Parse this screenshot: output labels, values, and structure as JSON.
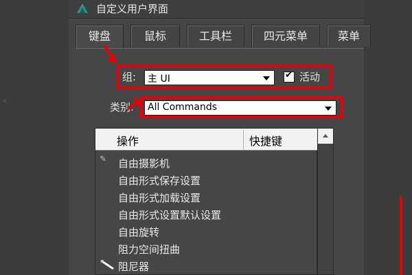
{
  "window": {
    "title": "自定义用户界面",
    "icon": "3dsmax-app-icon"
  },
  "tabs": [
    "键盘",
    "鼠标",
    "工具栏",
    "四元菜单",
    "菜单"
  ],
  "active_tab": "键盘",
  "group": {
    "label": "组:",
    "value": "主 UI",
    "active_label": "活动",
    "active_checked": true
  },
  "category": {
    "label": "类别:",
    "value": "All Commands"
  },
  "list": {
    "col_action": "操作",
    "col_shortcut": "快捷键",
    "items": [
      {
        "label": "自由摄影机",
        "icon": "camera-icon"
      },
      {
        "label": "自由形式保存设置",
        "icon": ""
      },
      {
        "label": "自由形式加载设置",
        "icon": ""
      },
      {
        "label": "自由形式设置默认设置",
        "icon": ""
      },
      {
        "label": "自由旋转",
        "icon": ""
      },
      {
        "label": "阻力空间扭曲",
        "icon": ""
      },
      {
        "label": "阻尼器",
        "icon": "damper-icon"
      }
    ]
  },
  "annotation_color": "#e1000b"
}
